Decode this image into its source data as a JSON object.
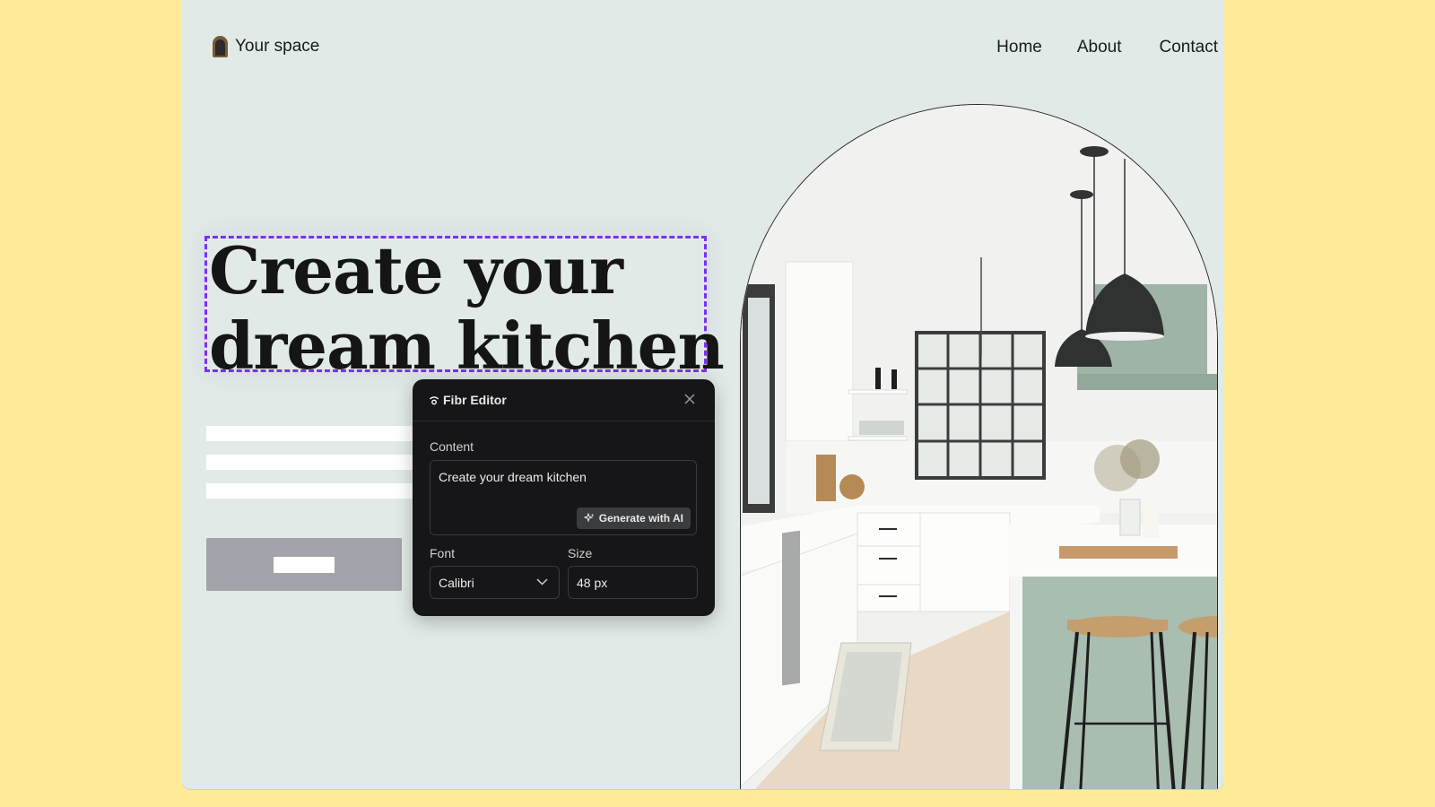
{
  "site": {
    "logo_icon": "arch-door-icon",
    "brand": "Your space",
    "nav": [
      {
        "label": "Home"
      },
      {
        "label": "About"
      },
      {
        "label": "Contact"
      }
    ]
  },
  "hero": {
    "headline_line1": "Create your",
    "headline_line2": "dream kitchen",
    "selection_color": "#7B2FF2",
    "image_description": "Bright white kitchen with sage green island, black pendant lamps, grid window and wooden bar stools"
  },
  "editor": {
    "title": "Fibr Editor",
    "title_icon": "signal-icon",
    "close_icon": "close-icon",
    "content_label": "Content",
    "content_value": "Create your dream kitchen",
    "generate_label": "Generate with AI",
    "generate_icon": "sparkle-icon",
    "font_label": "Font",
    "font_value": "Calibri",
    "size_label": "Size",
    "size_value": "48 px"
  },
  "colors": {
    "outer_background": "#FEEB9A",
    "page_background": "#E1EAE6",
    "editor_background": "#161618",
    "placeholder_button": "#A3A3AB"
  }
}
